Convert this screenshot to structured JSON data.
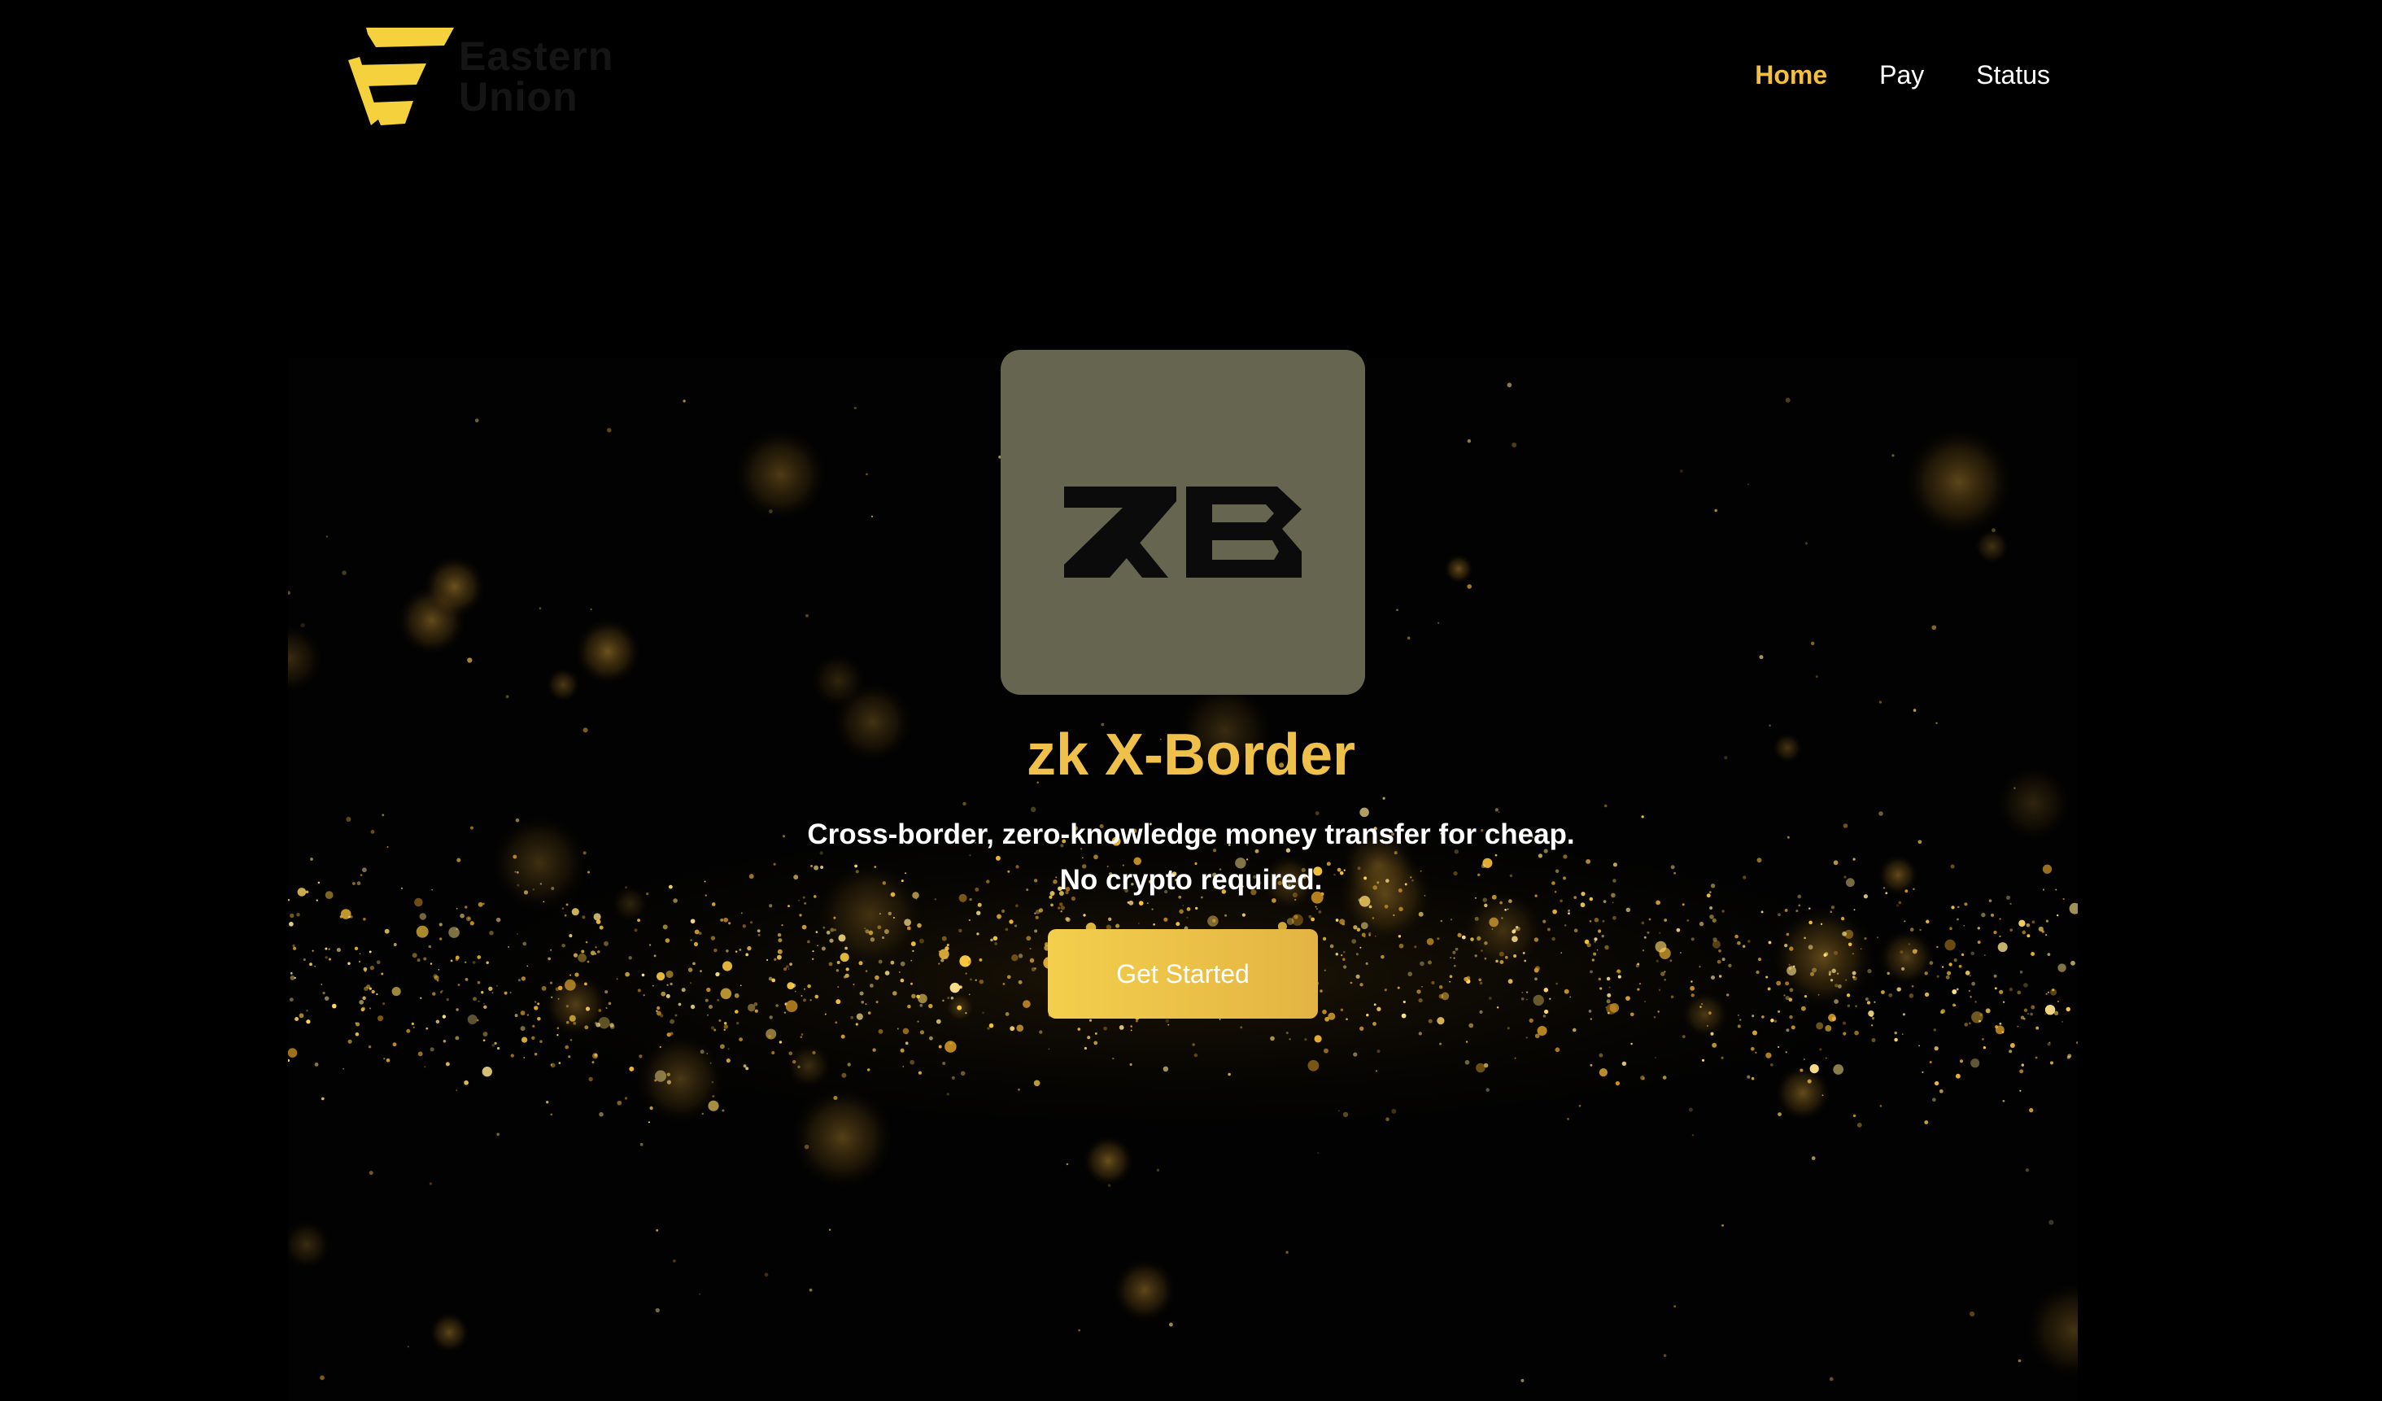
{
  "brand": {
    "name_line1": "Eastern",
    "name_line2": "Union",
    "logo_icon": "stacked-e-logo-icon",
    "logo_color": "#f5d13d"
  },
  "nav": {
    "items": [
      {
        "label": "Home",
        "active": true
      },
      {
        "label": "Pay",
        "active": false
      },
      {
        "label": "Status",
        "active": false
      }
    ],
    "active_color": "#f2bf42"
  },
  "hero": {
    "app_icon": "zb-logo-icon",
    "app_icon_text": "ZB",
    "title": "zk X-Border",
    "subtitle_line1": "Cross-border, zero-knowledge money transfer for cheap.",
    "subtitle_line2": "No crypto required.",
    "cta_label": "Get Started",
    "background": "gold-bokeh-particles",
    "accent": "#efc14b"
  }
}
